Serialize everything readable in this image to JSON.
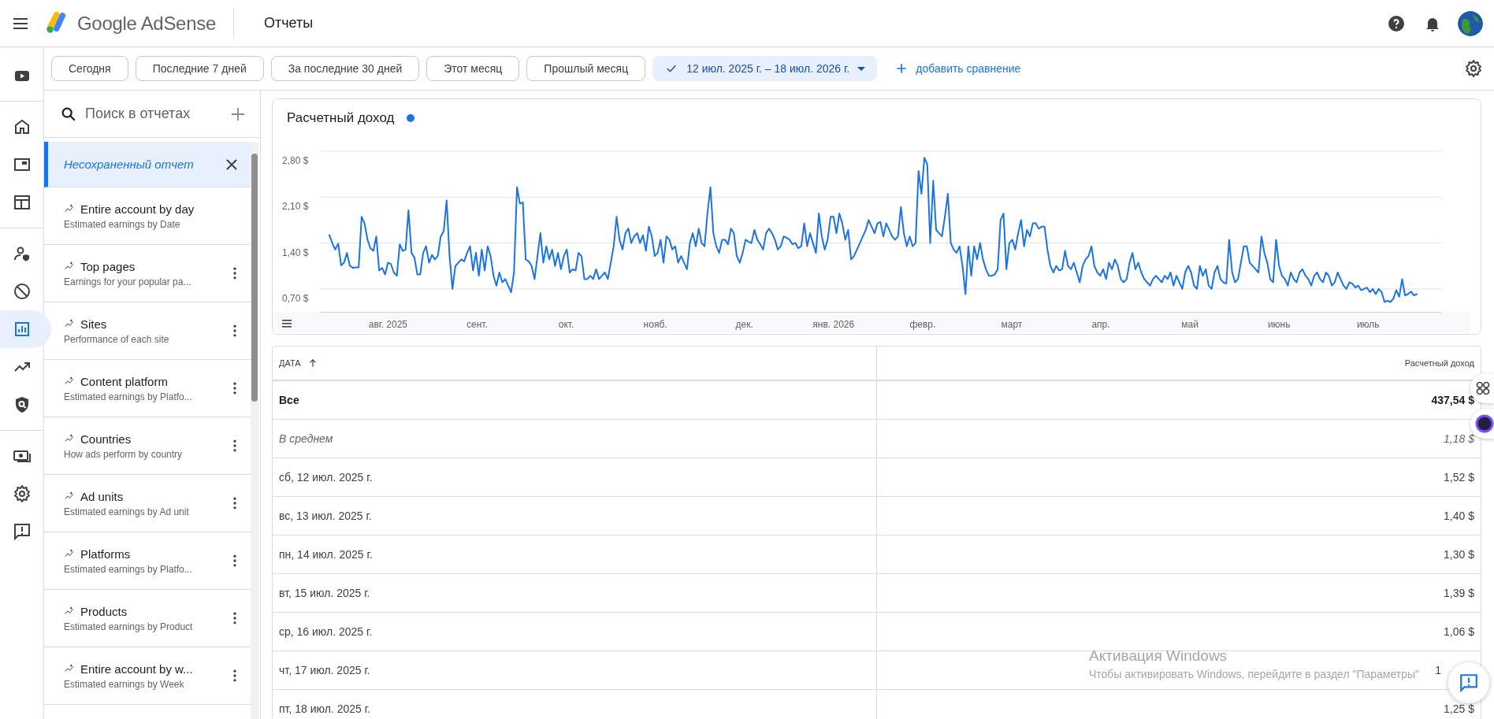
{
  "header": {
    "product": "Google AdSense",
    "page_title": "Отчеты"
  },
  "nav_rail": [
    {
      "kind": "video",
      "selected": false
    },
    {
      "kind": "home",
      "selected": false
    },
    {
      "kind": "display",
      "selected": false
    },
    {
      "kind": "layout",
      "selected": false
    },
    {
      "kind": "privacy",
      "selected": false
    },
    {
      "kind": "block",
      "selected": false
    },
    {
      "kind": "reports",
      "selected": true
    },
    {
      "kind": "trend",
      "selected": false
    },
    {
      "kind": "policy",
      "selected": false
    },
    {
      "kind": "payments",
      "selected": false
    },
    {
      "kind": "settings",
      "selected": false
    },
    {
      "kind": "feedback",
      "selected": false
    }
  ],
  "date_filters": [
    {
      "label": "Сегодня",
      "selected": false
    },
    {
      "label": "Последние 7 дней",
      "selected": false
    },
    {
      "label": "За последние 30 дней",
      "selected": false
    },
    {
      "label": "Этот месяц",
      "selected": false
    },
    {
      "label": "Прошлый месяц",
      "selected": false
    },
    {
      "label": "12 июл. 2025 г. – 18 июл. 2026 г.",
      "selected": true
    }
  ],
  "add_comparison": "добавить сравнение",
  "report_search": {
    "placeholder": "Поиск в отчетах"
  },
  "unsaved_report": "Несохраненный отчет",
  "reports": [
    {
      "title": "Entire account by day",
      "subtitle": "Estimated earnings by Date",
      "has_menu": false
    },
    {
      "title": "Top pages",
      "subtitle": "Earnings for your popular pa...",
      "has_menu": true
    },
    {
      "title": "Sites",
      "subtitle": "Performance of each site",
      "has_menu": true
    },
    {
      "title": "Content platform",
      "subtitle": "Estimated earnings by Platfo...",
      "has_menu": true
    },
    {
      "title": "Countries",
      "subtitle": "How ads perform by country",
      "has_menu": true
    },
    {
      "title": "Ad units",
      "subtitle": "Estimated earnings by Ad unit",
      "has_menu": true
    },
    {
      "title": "Platforms",
      "subtitle": "Estimated earnings by Platfo...",
      "has_menu": true
    },
    {
      "title": "Products",
      "subtitle": "Estimated earnings by Product",
      "has_menu": true
    },
    {
      "title": "Entire account by w...",
      "subtitle": "Estimated earnings by Week",
      "has_menu": true
    }
  ],
  "chart": {
    "month_labels": [
      "авг. 2025",
      "сент.",
      "окт.",
      "нояб.",
      "дек.",
      "янв. 2026",
      "февр.",
      "март",
      "апр.",
      "май",
      "июнь",
      "июль"
    ],
    "chart_data": {
      "type": "line",
      "grid": true,
      "ylim": [
        0.35,
        2.8
      ],
      "yticks": [
        {
          "value": 0.7,
          "label": "0,70 $"
        },
        {
          "value": 1.4,
          "label": "1,40 $"
        },
        {
          "value": 2.1,
          "label": "2,10 $"
        },
        {
          "value": 2.8,
          "label": "2,80 $"
        }
      ],
      "series": [
        {
          "name": "Расчетный доход",
          "color": "#1a73e8",
          "values": [
            1.52,
            1.4,
            1.3,
            1.39,
            1.06,
            1.1,
            1.25,
            1.05,
            1.02,
            1.03,
            1.03,
            1.8,
            1.7,
            1.45,
            1.32,
            1.28,
            1.5,
            0.98,
            1.02,
            0.92,
            1.1,
            1.08,
            0.95,
            0.9,
            1.38,
            1.28,
            1.3,
            1.9,
            1.25,
            1.18,
            0.92,
            0.92,
            1.25,
            1.35,
            1.1,
            1.22,
            1.15,
            1.2,
            1.5,
            1.58,
            2.05,
            1.2,
            0.7,
            1.05,
            1.1,
            1.15,
            1.12,
            1.25,
            1.35,
            0.98,
            1.25,
            0.9,
            1.3,
            0.98,
            1.35,
            1.2,
            0.9,
            0.75,
            0.95,
            0.8,
            0.85,
            0.75,
            0.65,
            0.95,
            2.25,
            2.0,
            2.02,
            1.15,
            1.12,
            1.05,
            0.85,
            1.2,
            1.55,
            1.1,
            1.35,
            1.15,
            1.3,
            1.05,
            1.25,
            1.0,
            1.2,
            1.3,
            0.95,
            1.0,
            0.98,
            1.25,
            1.2,
            0.85,
            0.85,
            0.9,
            0.85,
            1.0,
            0.85,
            0.9,
            0.95,
            0.85,
            1.1,
            1.35,
            1.8,
            1.45,
            1.3,
            1.55,
            1.62,
            1.4,
            1.5,
            1.55,
            1.4,
            1.52,
            1.28,
            1.65,
            1.5,
            1.2,
            1.25,
            1.45,
            1.1,
            1.5,
            1.45,
            1.3,
            1.35,
            1.1,
            1.2,
            1.1,
            1.0,
            1.4,
            1.55,
            1.35,
            1.62,
            1.4,
            1.35,
            1.85,
            2.25,
            1.55,
            1.35,
            1.25,
            1.45,
            1.45,
            1.38,
            1.62,
            1.55,
            1.2,
            1.1,
            1.25,
            1.45,
            1.42,
            1.4,
            1.6,
            1.45,
            1.38,
            1.3,
            1.55,
            1.62,
            1.55,
            1.45,
            1.3,
            1.35,
            1.5,
            1.48,
            1.45,
            1.38,
            1.4,
            1.32,
            1.35,
            1.7,
            1.35,
            1.55,
            1.4,
            1.25,
            1.85,
            1.5,
            1.3,
            1.45,
            1.8,
            1.8,
            1.55,
            1.85,
            1.7,
            1.45,
            1.6,
            1.15,
            1.2,
            1.3,
            1.4,
            1.5,
            1.6,
            1.75,
            1.65,
            1.55,
            1.7,
            1.72,
            1.5,
            1.7,
            1.6,
            1.5,
            1.45,
            1.5,
            1.95,
            1.55,
            1.35,
            1.5,
            1.35,
            1.4,
            2.5,
            2.15,
            2.7,
            2.6,
            1.4,
            2.35,
            1.6,
            1.55,
            1.5,
            1.8,
            2.15,
            1.4,
            1.3,
            1.25,
            1.35,
            1.05,
            0.62,
            1.35,
            0.9,
            1.35,
            1.15,
            1.4,
            1.15,
            1.0,
            0.9,
            0.9,
            0.92,
            1.0,
            1.75,
            1.85,
            1.0,
            1.4,
            1.45,
            1.3,
            1.55,
            1.75,
            1.35,
            1.6,
            1.5,
            1.7,
            1.7,
            1.62,
            1.65,
            1.65,
            1.3,
            1.05,
            0.95,
            1.05,
            0.98,
            1.0,
            1.28,
            1.05,
            1.0,
            1.1,
            0.95,
            0.8,
            1.05,
            1.15,
            1.2,
            1.35,
            1.05,
            0.95,
            0.9,
            1.0,
            0.85,
            1.1,
            1.0,
            1.15,
            1.05,
            0.85,
            0.8,
            0.85,
            1.1,
            1.25,
            1.0,
            1.1,
            0.95,
            0.85,
            0.8,
            0.75,
            0.85,
            0.9,
            0.85,
            0.8,
            0.9,
            0.85,
            0.95,
            0.75,
            0.9,
            0.8,
            0.7,
            0.95,
            1.05,
            0.95,
            0.75,
            0.7,
            1.05,
            0.9,
            1.0,
            0.75,
            0.7,
            0.95,
            1.05,
            0.85,
            0.8,
            0.78,
            1.45,
            0.95,
            0.8,
            0.85,
            1.1,
            1.35,
            1.35,
            1.1,
            1.05,
            1.0,
            0.95,
            1.5,
            1.25,
            1.1,
            0.85,
            0.8,
            1.45,
            1.05,
            0.9,
            0.85,
            0.75,
            0.95,
            0.85,
            0.8,
            0.95,
            1.0,
            0.9,
            0.85,
            0.75,
            0.9,
            0.95,
            0.85,
            0.8,
            0.95,
            0.9,
            0.75,
            0.8,
            0.95,
            0.85,
            0.75,
            0.7,
            0.8,
            0.78,
            0.72,
            0.75,
            0.68,
            0.7,
            0.72,
            0.65,
            0.7,
            0.62,
            0.7,
            0.65,
            0.5,
            0.52,
            0.5,
            0.55,
            0.68,
            0.58,
            0.85,
            0.6,
            0.62,
            0.66,
            0.6,
            0.62
          ]
        }
      ]
    }
  },
  "table": {
    "columns": [
      {
        "label": "ДАТА",
        "sorted": true
      },
      {
        "label": "Расчетный доход",
        "sorted": false
      }
    ],
    "rows": [
      {
        "kind": "total",
        "date": "Все",
        "value": "437,54 $"
      },
      {
        "kind": "average",
        "date": "В среднем",
        "value": "1,18 $"
      },
      {
        "kind": "day",
        "date": "сб, 12 июл. 2025 г.",
        "value": "1,52 $"
      },
      {
        "kind": "day",
        "date": "вс, 13 июл. 2025 г.",
        "value": "1,40 $"
      },
      {
        "kind": "day",
        "date": "пн, 14 июл. 2025 г.",
        "value": "1,30 $"
      },
      {
        "kind": "day",
        "date": "вт, 15 июл. 2025 г.",
        "value": "1,39 $"
      },
      {
        "kind": "day",
        "date": "ср, 16 июл. 2025 г.",
        "value": "1,06 $"
      },
      {
        "kind": "day_covered",
        "date": "чт, 17 июл. 2025 г.",
        "value": "1"
      },
      {
        "kind": "day",
        "date": "пт, 18 июл. 2025 г.",
        "value": "1,25 $"
      }
    ]
  },
  "os_overlay": {
    "title": "Активация Windows",
    "text": "Чтобы активировать Windows, перейдите в раздел \"Параметры\""
  }
}
